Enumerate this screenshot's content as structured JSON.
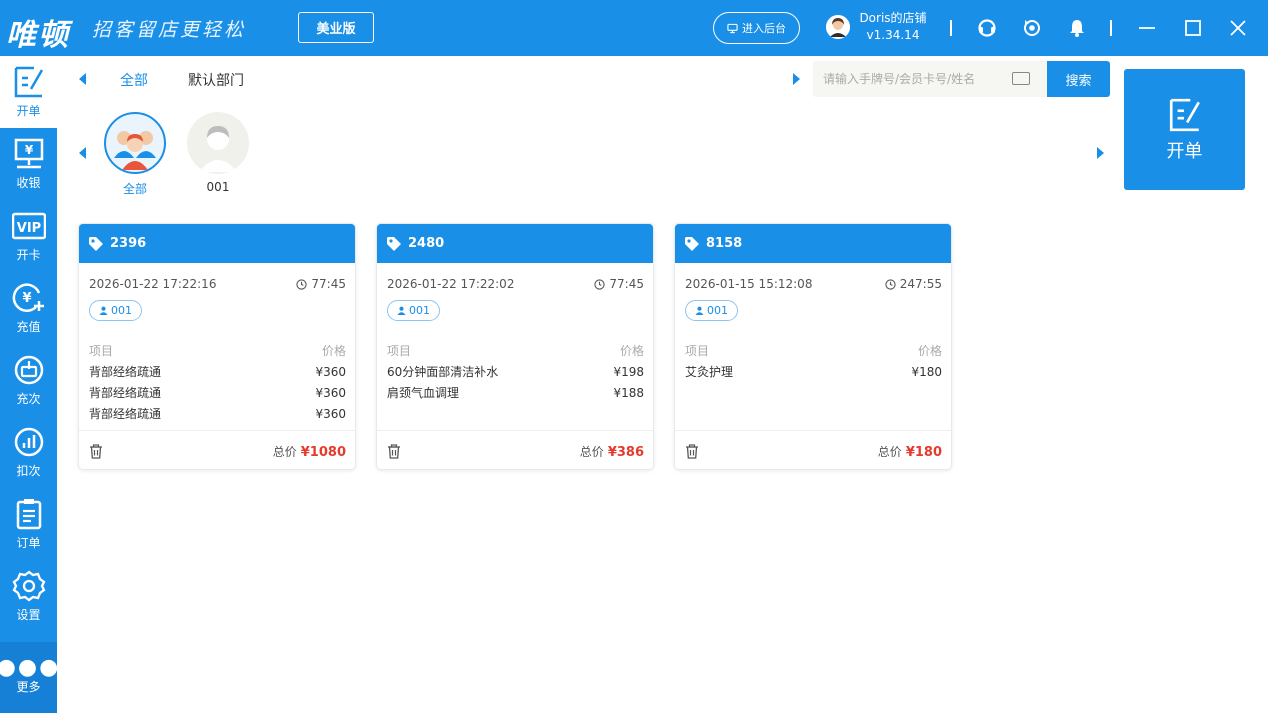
{
  "topbar": {
    "brand": "唯顿",
    "slogan": "招客留店更轻松",
    "edition": "美业版",
    "backend_label": "进入后台",
    "store_name": "Doris的店铺",
    "version": "v1.34.14",
    "icons": [
      "headset-icon",
      "sync-icon",
      "bell-icon",
      "minimize-icon",
      "maximize-icon",
      "close-icon"
    ]
  },
  "sidebar": {
    "items": [
      {
        "label": "开单",
        "icon": "edit-order-icon"
      },
      {
        "label": "收银",
        "icon": "cashier-icon"
      },
      {
        "label": "开卡",
        "icon": "vip-card-icon"
      },
      {
        "label": "充值",
        "icon": "recharge-icon"
      },
      {
        "label": "充次",
        "icon": "recharge-times-icon"
      },
      {
        "label": "扣次",
        "icon": "deduct-times-icon"
      },
      {
        "label": "订单",
        "icon": "order-list-icon"
      },
      {
        "label": "设置",
        "icon": "settings-icon"
      },
      {
        "label": "更多",
        "icon": "more-icon"
      }
    ]
  },
  "departments": {
    "tabs": [
      "全部",
      "默认部门"
    ]
  },
  "search": {
    "placeholder": "请输入手牌号/会员卡号/姓名",
    "button": "搜索"
  },
  "open_button": {
    "label": "开单"
  },
  "staff": [
    {
      "label": "全部"
    },
    {
      "label": "001"
    }
  ],
  "labels": {
    "item_col": "项目",
    "price_col": "价格",
    "total_label": "总价"
  },
  "orders": [
    {
      "number": "2396",
      "datetime": "2026-01-22 17:22:16",
      "duration": "77:45",
      "staff_tag": "001",
      "items": [
        {
          "name": "背部经络疏通",
          "price": "¥360"
        },
        {
          "name": "背部经络疏通",
          "price": "¥360"
        },
        {
          "name": "背部经络疏通",
          "price": "¥360"
        }
      ],
      "total": "¥1080"
    },
    {
      "number": "2480",
      "datetime": "2026-01-22 17:22:02",
      "duration": "77:45",
      "staff_tag": "001",
      "items": [
        {
          "name": "60分钟面部清洁补水",
          "price": "¥198"
        },
        {
          "name": "肩颈气血调理",
          "price": "¥188"
        }
      ],
      "total": "¥386"
    },
    {
      "number": "8158",
      "datetime": "2026-01-15 15:12:08",
      "duration": "247:55",
      "staff_tag": "001",
      "items": [
        {
          "name": "艾灸护理",
          "price": "¥180"
        }
      ],
      "total": "¥180"
    }
  ],
  "colors": {
    "primary": "#1a8fe8",
    "price": "#e53b2c"
  }
}
